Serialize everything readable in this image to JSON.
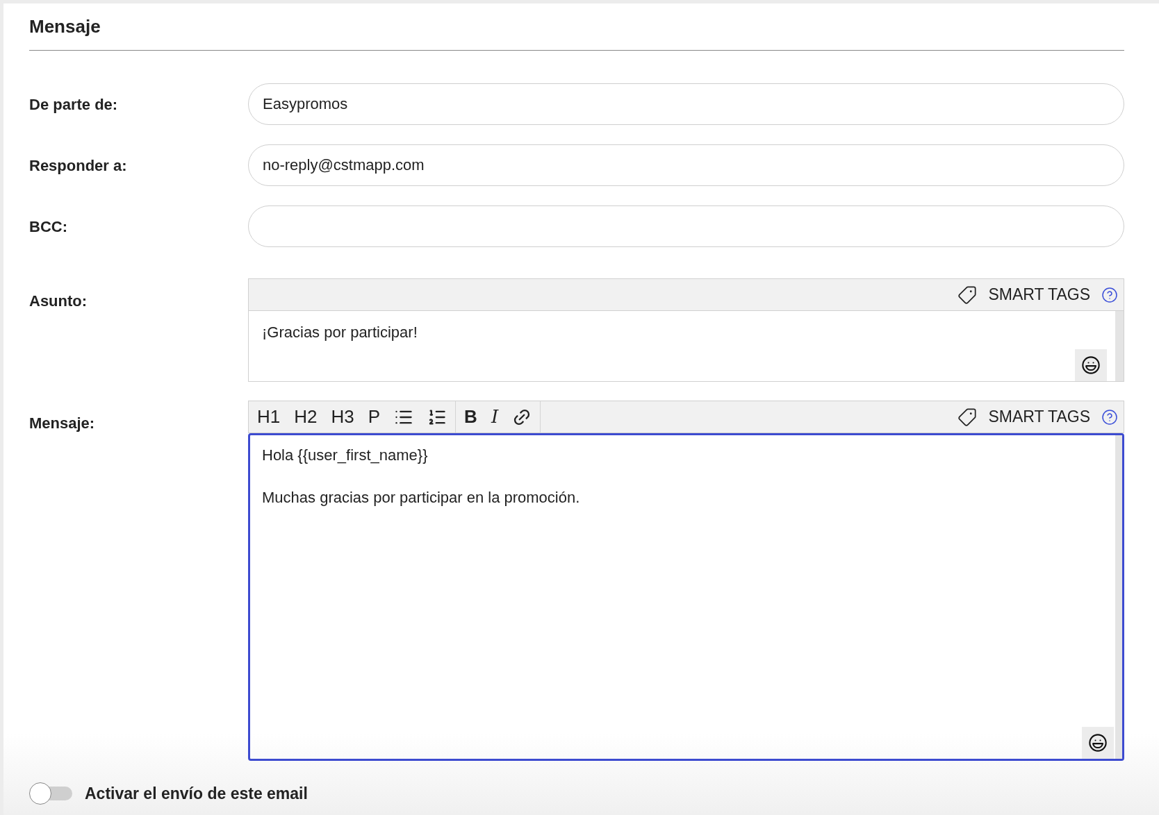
{
  "section_title": "Mensaje",
  "fields": [
    {
      "label": "De parte de:",
      "value": "Easypromos"
    },
    {
      "label": "Responder a:",
      "value": "no-reply@cstmapp.com"
    },
    {
      "label": "BCC:"
    }
  ],
  "subject": {
    "label": "Asunto:",
    "smart_tags": "SMART TAGS",
    "value": "¡Gracias por participar!",
    "focused": false
  },
  "message": {
    "label": "Mensaje:",
    "smart_tags": "SMART TAGS",
    "focused": true,
    "toolbar": [
      [
        {
          "kind": "text",
          "label": "H1"
        },
        {
          "kind": "text",
          "label": "H2"
        },
        {
          "kind": "text",
          "label": "H3"
        },
        {
          "kind": "text",
          "label": "P"
        },
        {
          "kind": "bullet-list"
        },
        {
          "kind": "numbered-list"
        }
      ],
      [
        {
          "kind": "bold",
          "label": "B"
        },
        {
          "kind": "italic",
          "label": "I"
        },
        {
          "kind": "link"
        }
      ]
    ],
    "paragraphs": [
      "Hola {{user_first_name}}",
      "Muchas gracias por participar en la promoción."
    ]
  },
  "toggle": {
    "label": "Activar el envío de este email",
    "on": false
  }
}
